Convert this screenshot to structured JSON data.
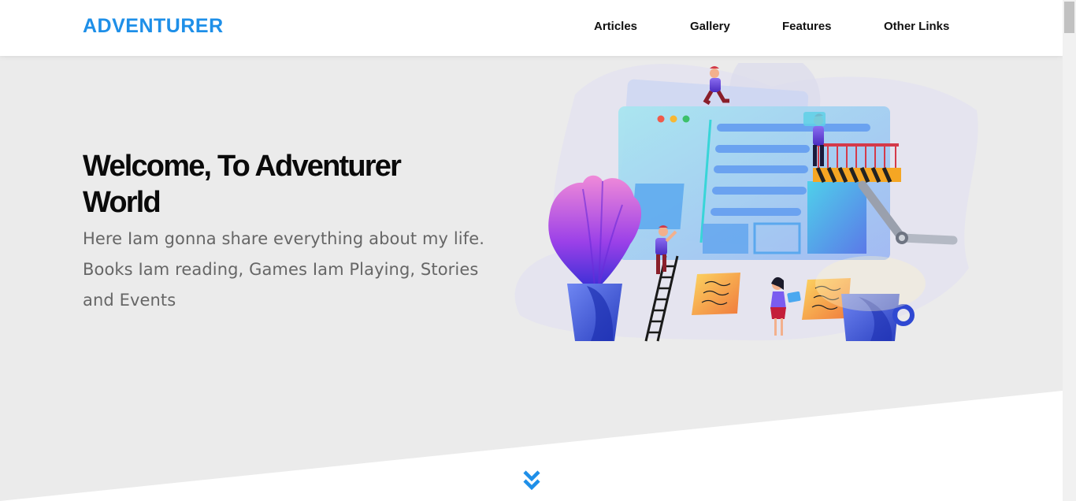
{
  "header": {
    "logo": "ADVENTURER",
    "nav": [
      {
        "label": "Articles"
      },
      {
        "label": "Gallery"
      },
      {
        "label": "Features"
      },
      {
        "label": "Other Links"
      }
    ]
  },
  "hero": {
    "title": "Welcome, To Adventurer World",
    "text": "Here Iam gonna share everything about my life. Books Iam reading, Games Iam Playing, Stories and Events"
  },
  "icons": {
    "scroll_down": "double-chevron-down-icon",
    "illustration": "website-builders-illustration"
  },
  "colors": {
    "brand": "#1e8fe8",
    "hero_bg": "#ebebeb",
    "heading": "#0a0a0a",
    "body_text": "#666666"
  }
}
